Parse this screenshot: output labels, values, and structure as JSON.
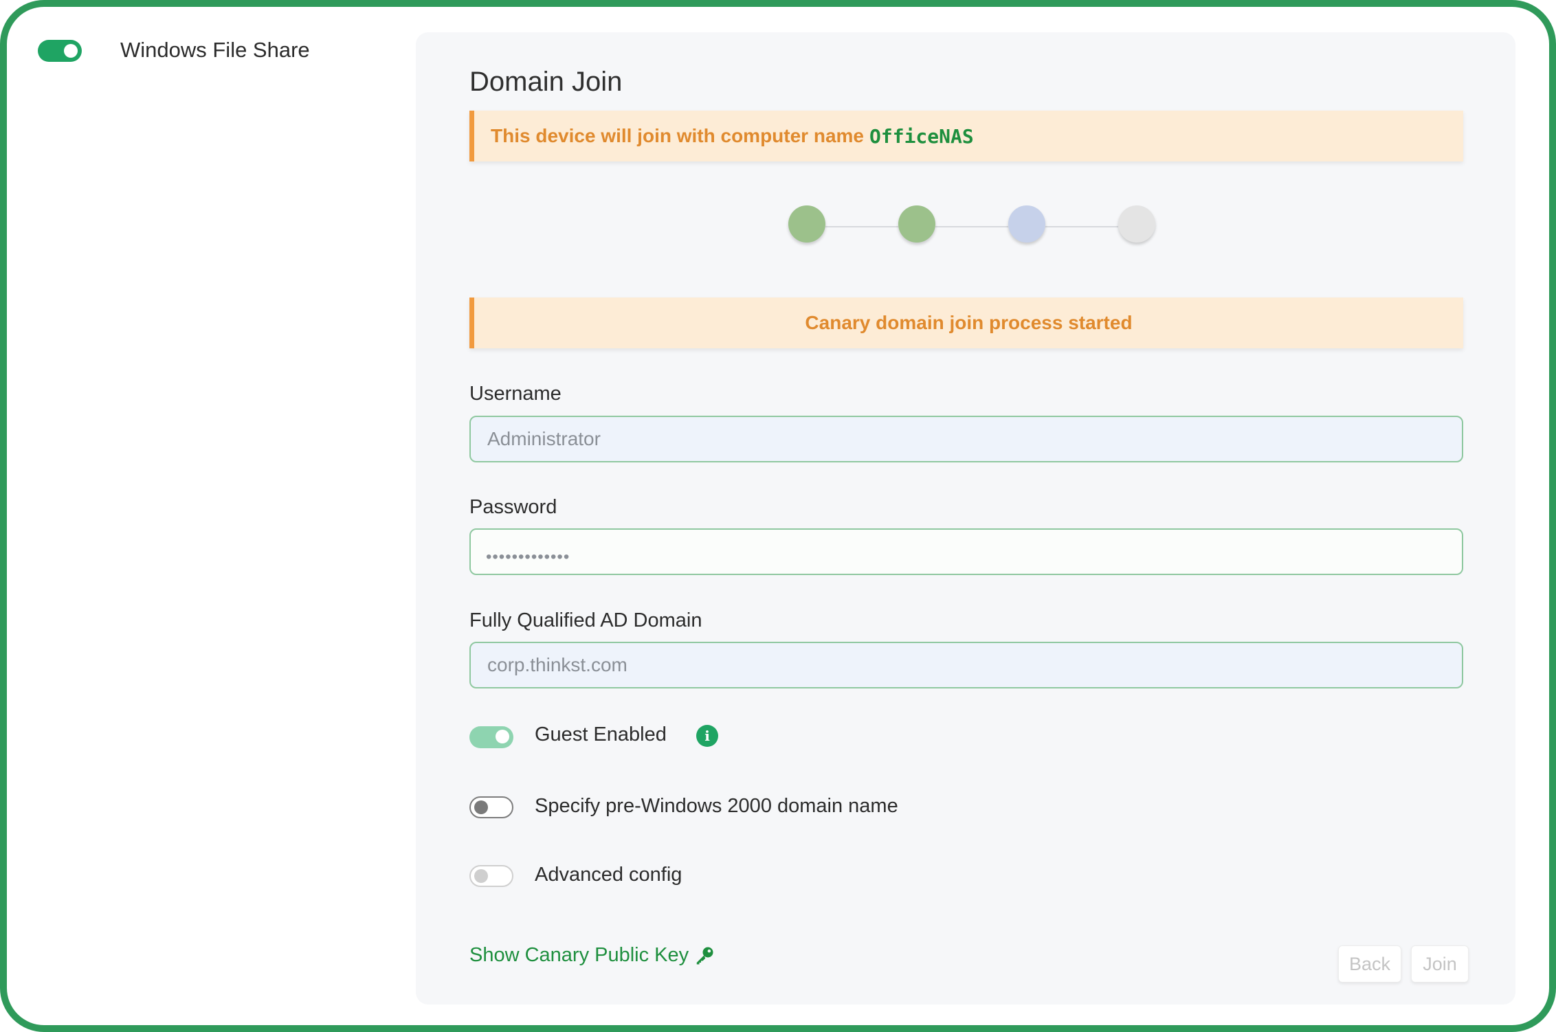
{
  "sidebar": {
    "service_toggle_on": true,
    "service_title": "Windows File Share"
  },
  "panel": {
    "title": "Domain Join",
    "banner_prefix": "This device will join with computer name",
    "computer_name": "OfficeNAS",
    "status_message": "Canary domain join process started",
    "steps": [
      {
        "state": "complete",
        "color": "#9cc18b"
      },
      {
        "state": "complete",
        "color": "#9cc18b"
      },
      {
        "state": "active",
        "color": "#c6d1ea"
      },
      {
        "state": "pending",
        "color": "#e4e4e4"
      }
    ]
  },
  "form": {
    "username_label": "Username",
    "username_placeholder": "Administrator",
    "password_label": "Password",
    "password_masked": "•••••••••••••",
    "domain_label": "Fully Qualified AD Domain",
    "domain_placeholder": "corp.thinkst.com"
  },
  "options": {
    "guest_label": "Guest Enabled",
    "guest_on": true,
    "pre2000_label": "Specify pre-Windows 2000 domain name",
    "pre2000_on": false,
    "advanced_label": "Advanced config",
    "advanced_on": false,
    "advanced_disabled": true
  },
  "links": {
    "public_key_label": "Show Canary Public Key"
  },
  "buttons": {
    "back_label": "Back",
    "join_label": "Join"
  },
  "colors": {
    "accent_green": "#1fa463",
    "frame_green": "#2f9a5a",
    "warning_orange": "#f19a3e",
    "warning_bg": "#fdecd6"
  }
}
